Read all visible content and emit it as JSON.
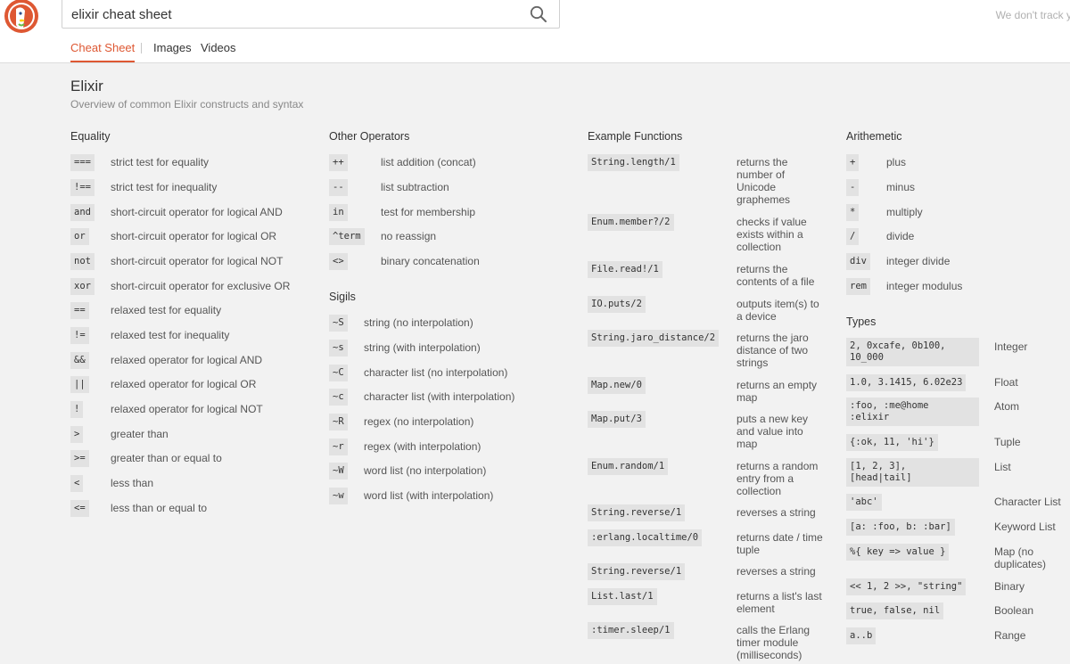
{
  "search": {
    "query": "elixir cheat sheet"
  },
  "track_text": "We don't track y",
  "tabs": [
    "Cheat Sheet",
    "Images",
    "Videos"
  ],
  "page": {
    "title": "Elixir",
    "subtitle": "Overview of common Elixir constructs and syntax"
  },
  "equality": {
    "heading": "Equality",
    "items": [
      {
        "code": "===",
        "desc": "strict test for equality"
      },
      {
        "code": "!==",
        "desc": "strict test for inequality"
      },
      {
        "code": "and",
        "desc": "short-circuit operator for logical AND"
      },
      {
        "code": "or",
        "desc": "short-circuit operator for logical OR"
      },
      {
        "code": "not",
        "desc": "short-circuit operator for logical NOT"
      },
      {
        "code": "xor",
        "desc": "short-circuit operator for exclusive OR"
      },
      {
        "code": "==",
        "desc": "relaxed test for equality"
      },
      {
        "code": "!=",
        "desc": "relaxed test for inequality"
      },
      {
        "code": "&&",
        "desc": "relaxed operator for logical AND"
      },
      {
        "code": "||",
        "desc": "relaxed operator for logical OR"
      },
      {
        "code": "!",
        "desc": "relaxed operator for logical NOT"
      },
      {
        "code": ">",
        "desc": "greater than"
      },
      {
        "code": ">=",
        "desc": "greater than or equal to"
      },
      {
        "code": "<",
        "desc": "less than"
      },
      {
        "code": "<=",
        "desc": "less than or equal to"
      }
    ]
  },
  "other_operators": {
    "heading": "Other Operators",
    "items": [
      {
        "code": "++",
        "desc": "list addition (concat)"
      },
      {
        "code": "--",
        "desc": "list subtraction"
      },
      {
        "code": "in",
        "desc": "test for membership"
      },
      {
        "code": "^term",
        "desc": "no reassign"
      },
      {
        "code": "<>",
        "desc": "binary concatenation"
      }
    ]
  },
  "sigils": {
    "heading": "Sigils",
    "items": [
      {
        "code": "~S",
        "desc": "string (no interpolation)"
      },
      {
        "code": "~s",
        "desc": "string (with interpolation)"
      },
      {
        "code": "~C",
        "desc": "character list (no interpolation)"
      },
      {
        "code": "~c",
        "desc": "character list (with interpolation)"
      },
      {
        "code": "~R",
        "desc": "regex (no interpolation)"
      },
      {
        "code": "~r",
        "desc": "regex (with interpolation)"
      },
      {
        "code": "~W",
        "desc": "word list (no interpolation)"
      },
      {
        "code": "~w",
        "desc": "word list (with interpolation)"
      }
    ]
  },
  "example_functions": {
    "heading": "Example Functions",
    "items": [
      {
        "code": "String.length/1",
        "desc": "returns the number of Unicode graphemes"
      },
      {
        "code": "Enum.member?/2",
        "desc": "checks if value exists within a collection"
      },
      {
        "code": "File.read!/1",
        "desc": "returns the contents of a file"
      },
      {
        "code": "IO.puts/2",
        "desc": "outputs item(s) to a device"
      },
      {
        "code": "String.jaro_distance/2",
        "desc": "returns the jaro distance of two strings"
      },
      {
        "code": "Map.new/0",
        "desc": "returns an empty map"
      },
      {
        "code": "Map.put/3",
        "desc": "puts a new key and value into map"
      },
      {
        "code": "Enum.random/1",
        "desc": "returns a random entry from a collection"
      },
      {
        "code": "String.reverse/1",
        "desc": "reverses a string"
      },
      {
        "code": ":erlang.localtime/0",
        "desc": "returns date / time tuple"
      },
      {
        "code": "String.reverse/1",
        "desc": "reverses a string"
      },
      {
        "code": "List.last/1",
        "desc": "returns a list's last element"
      },
      {
        "code": ":timer.sleep/1",
        "desc": "calls the Erlang timer module (milliseconds)"
      }
    ]
  },
  "arithmetic": {
    "heading": "Arithemetic",
    "items": [
      {
        "code": "+",
        "desc": "plus"
      },
      {
        "code": "-",
        "desc": "minus"
      },
      {
        "code": "*",
        "desc": "multiply"
      },
      {
        "code": "/",
        "desc": "divide"
      },
      {
        "code": "div",
        "desc": "integer divide"
      },
      {
        "code": "rem",
        "desc": "integer modulus"
      }
    ]
  },
  "types": {
    "heading": "Types",
    "items": [
      {
        "code": "2, 0xcafe, 0b100,\n10_000",
        "desc": "Integer"
      },
      {
        "code": "1.0, 3.1415, 6.02e23",
        "desc": "Float"
      },
      {
        "code": ":foo, :me@home\n:elixir",
        "desc": "Atom"
      },
      {
        "code": "{:ok, 11, 'hi'}",
        "desc": "Tuple"
      },
      {
        "code": "[1, 2, 3],\n[head|tail]",
        "desc": "List"
      },
      {
        "code": "'abc'",
        "desc": "Character List"
      },
      {
        "code": "[a: :foo, b: :bar]",
        "desc": "Keyword List"
      },
      {
        "code": "%{ key => value }",
        "desc": "Map (no duplicates)"
      },
      {
        "code": "<< 1, 2 >>, \"string\"",
        "desc": "Binary"
      },
      {
        "code": "true, false, nil",
        "desc": "Boolean"
      },
      {
        "code": "a..b",
        "desc": "Range"
      }
    ]
  }
}
